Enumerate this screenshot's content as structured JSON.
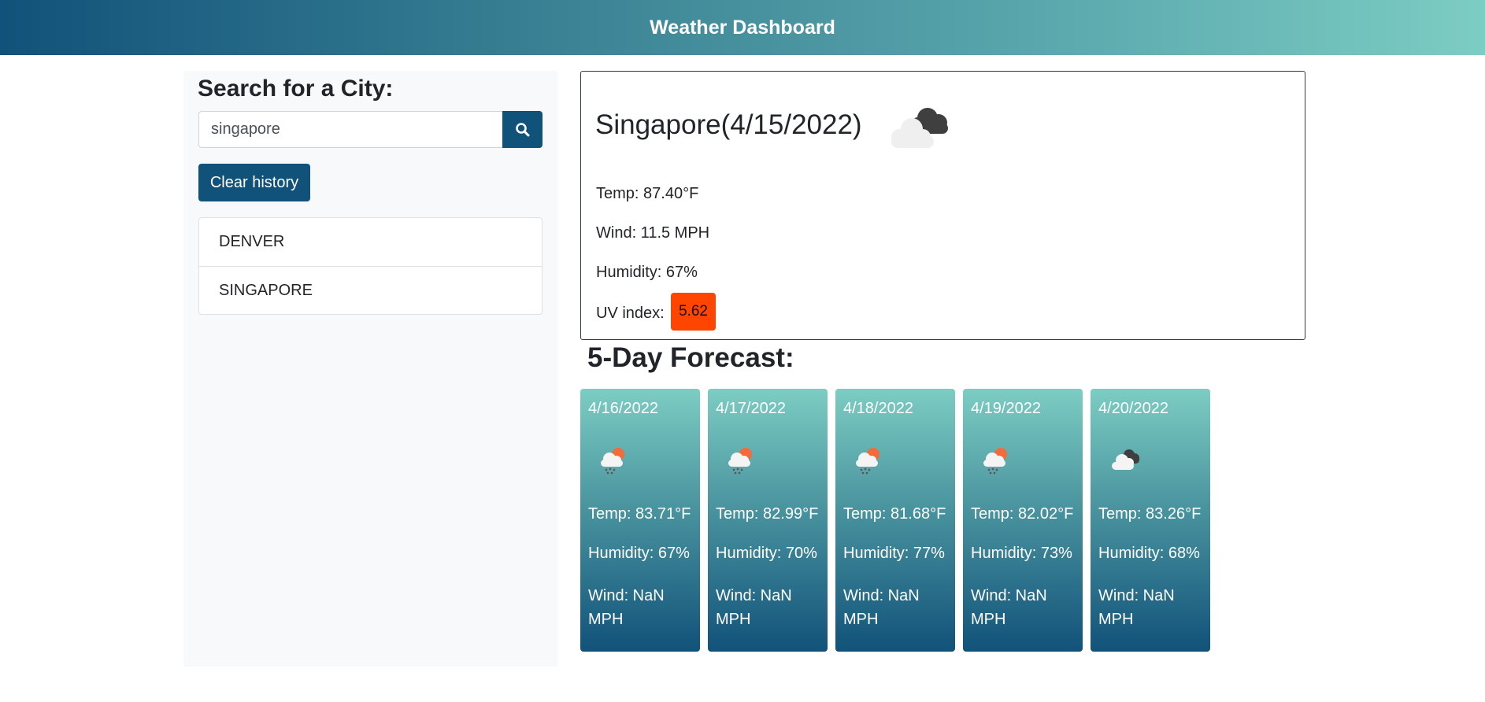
{
  "header": {
    "title": "Weather Dashboard"
  },
  "search": {
    "heading": "Search for a City:",
    "value": "singapore",
    "button_icon": "search-icon",
    "clear_label": "Clear history"
  },
  "history": [
    "DENVER",
    "SINGAPORE"
  ],
  "current": {
    "title": "Singapore(4/15/2022)",
    "icon": "cloudy-icon",
    "temp": "Temp: 87.40°F",
    "wind": "Wind: 11.5 MPH",
    "humidity": "Humidity: 67%",
    "uv_label": "UV index:",
    "uv_value": "5.62",
    "uv_color": "#ff4500"
  },
  "forecast": {
    "title": "5-Day Forecast:",
    "days": [
      {
        "date": "4/16/2022",
        "icon": "rain-sun-icon",
        "temp": "Temp: 83.71°F",
        "humidity": "Humidity: 67%",
        "wind": "Wind: NaN MPH"
      },
      {
        "date": "4/17/2022",
        "icon": "rain-sun-icon",
        "temp": "Temp: 82.99°F",
        "humidity": "Humidity: 70%",
        "wind": "Wind: NaN MPH"
      },
      {
        "date": "4/18/2022",
        "icon": "rain-sun-icon",
        "temp": "Temp: 81.68°F",
        "humidity": "Humidity: 77%",
        "wind": "Wind: NaN MPH"
      },
      {
        "date": "4/19/2022",
        "icon": "rain-sun-icon",
        "temp": "Temp: 82.02°F",
        "humidity": "Humidity: 73%",
        "wind": "Wind: NaN MPH"
      },
      {
        "date": "4/20/2022",
        "icon": "cloudy-icon",
        "temp": "Temp: 83.26°F",
        "humidity": "Humidity: 68%",
        "wind": "Wind: NaN MPH"
      }
    ]
  },
  "colors": {
    "brand": "#11527a",
    "gradient_light": "#7ccdc3"
  }
}
